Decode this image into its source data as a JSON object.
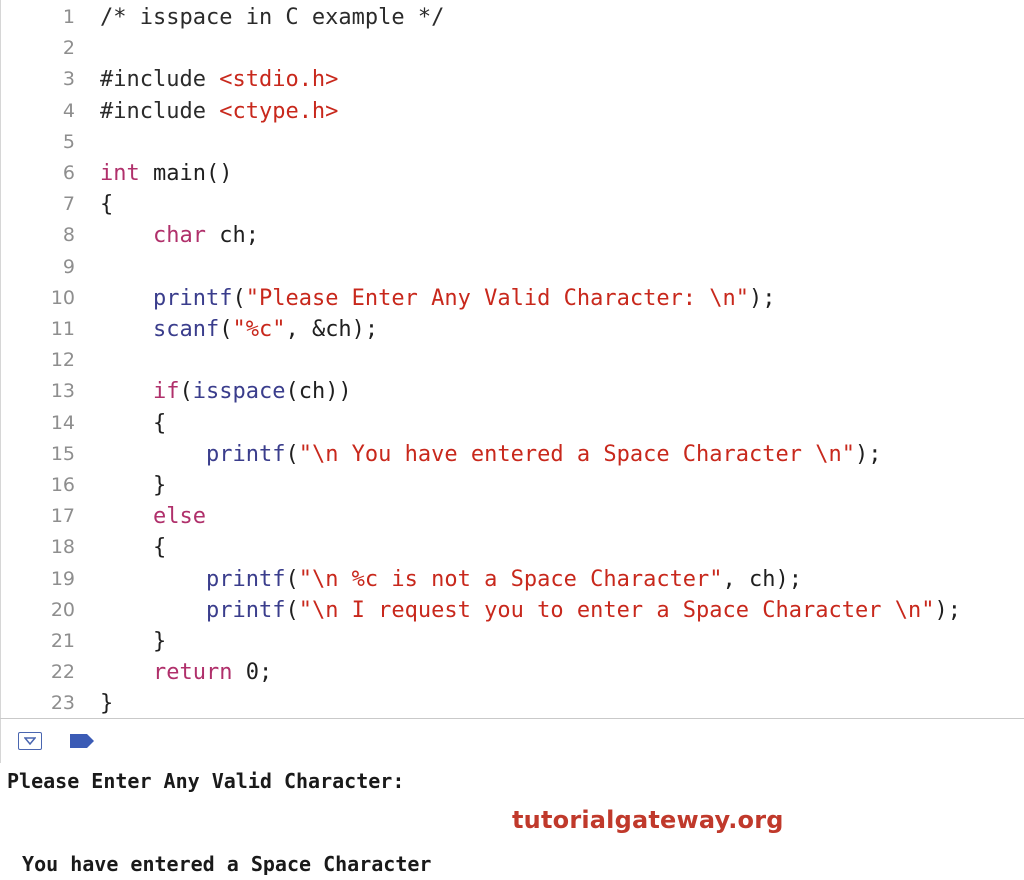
{
  "editor": {
    "lines": [
      {
        "n": "1",
        "tokens": [
          {
            "t": "/* isspace in C example */",
            "c": "comment"
          }
        ]
      },
      {
        "n": "2",
        "tokens": []
      },
      {
        "n": "3",
        "tokens": [
          {
            "t": "#include ",
            "c": "pre"
          },
          {
            "t": "<stdio.h>",
            "c": "str"
          }
        ]
      },
      {
        "n": "4",
        "tokens": [
          {
            "t": "#include ",
            "c": "pre"
          },
          {
            "t": "<ctype.h>",
            "c": "str"
          }
        ]
      },
      {
        "n": "5",
        "tokens": []
      },
      {
        "n": "6",
        "tokens": [
          {
            "t": "int",
            "c": "kw"
          },
          {
            "t": " main()",
            "c": "plain"
          }
        ]
      },
      {
        "n": "7",
        "tokens": [
          {
            "t": "{",
            "c": "plain"
          }
        ]
      },
      {
        "n": "8",
        "tokens": [
          {
            "t": "    ",
            "c": "plain"
          },
          {
            "t": "char",
            "c": "kw"
          },
          {
            "t": " ch;",
            "c": "plain"
          }
        ]
      },
      {
        "n": "9",
        "tokens": []
      },
      {
        "n": "10",
        "tokens": [
          {
            "t": "    ",
            "c": "plain"
          },
          {
            "t": "printf",
            "c": "fn"
          },
          {
            "t": "(",
            "c": "plain"
          },
          {
            "t": "\"Please Enter Any Valid Character: \\n\"",
            "c": "str"
          },
          {
            "t": ");",
            "c": "plain"
          }
        ]
      },
      {
        "n": "11",
        "tokens": [
          {
            "t": "    ",
            "c": "plain"
          },
          {
            "t": "scanf",
            "c": "fn"
          },
          {
            "t": "(",
            "c": "plain"
          },
          {
            "t": "\"%c\"",
            "c": "str"
          },
          {
            "t": ", &ch);",
            "c": "plain"
          }
        ]
      },
      {
        "n": "12",
        "tokens": []
      },
      {
        "n": "13",
        "tokens": [
          {
            "t": "    ",
            "c": "plain"
          },
          {
            "t": "if",
            "c": "kw"
          },
          {
            "t": "(",
            "c": "plain"
          },
          {
            "t": "isspace",
            "c": "fn"
          },
          {
            "t": "(ch))",
            "c": "plain"
          }
        ]
      },
      {
        "n": "14",
        "tokens": [
          {
            "t": "    {",
            "c": "plain"
          }
        ]
      },
      {
        "n": "15",
        "tokens": [
          {
            "t": "        ",
            "c": "plain"
          },
          {
            "t": "printf",
            "c": "fn"
          },
          {
            "t": "(",
            "c": "plain"
          },
          {
            "t": "\"\\n You have entered a Space Character \\n\"",
            "c": "str"
          },
          {
            "t": ");",
            "c": "plain"
          }
        ]
      },
      {
        "n": "16",
        "tokens": [
          {
            "t": "    }",
            "c": "plain"
          }
        ]
      },
      {
        "n": "17",
        "tokens": [
          {
            "t": "    ",
            "c": "plain"
          },
          {
            "t": "else",
            "c": "kw"
          }
        ]
      },
      {
        "n": "18",
        "tokens": [
          {
            "t": "    {",
            "c": "plain"
          }
        ]
      },
      {
        "n": "19",
        "tokens": [
          {
            "t": "        ",
            "c": "plain"
          },
          {
            "t": "printf",
            "c": "fn"
          },
          {
            "t": "(",
            "c": "plain"
          },
          {
            "t": "\"\\n %c is not a Space Character\"",
            "c": "str"
          },
          {
            "t": ", ch);",
            "c": "plain"
          }
        ]
      },
      {
        "n": "20",
        "tokens": [
          {
            "t": "        ",
            "c": "plain"
          },
          {
            "t": "printf",
            "c": "fn"
          },
          {
            "t": "(",
            "c": "plain"
          },
          {
            "t": "\"\\n I request you to enter a Space Character \\n\"",
            "c": "str"
          },
          {
            "t": ");",
            "c": "plain"
          }
        ]
      },
      {
        "n": "21",
        "tokens": [
          {
            "t": "    }",
            "c": "plain"
          }
        ]
      },
      {
        "n": "22",
        "tokens": [
          {
            "t": "    ",
            "c": "plain"
          },
          {
            "t": "return",
            "c": "kw"
          },
          {
            "t": " 0;",
            "c": "plain"
          }
        ]
      },
      {
        "n": "23",
        "tokens": [
          {
            "t": "}",
            "c": "plain"
          }
        ]
      }
    ]
  },
  "debug_bar": {
    "toggle_icon": "triangle-down-icon",
    "flag_icon": "breakpoint-flag-icon",
    "accent_color": "#4a66b0"
  },
  "console": {
    "line1": "Please Enter Any Valid Character: ",
    "line2": " You have entered a Space Character"
  },
  "watermark": {
    "text": "tutorialgateway.org",
    "color": "#c0392b"
  }
}
